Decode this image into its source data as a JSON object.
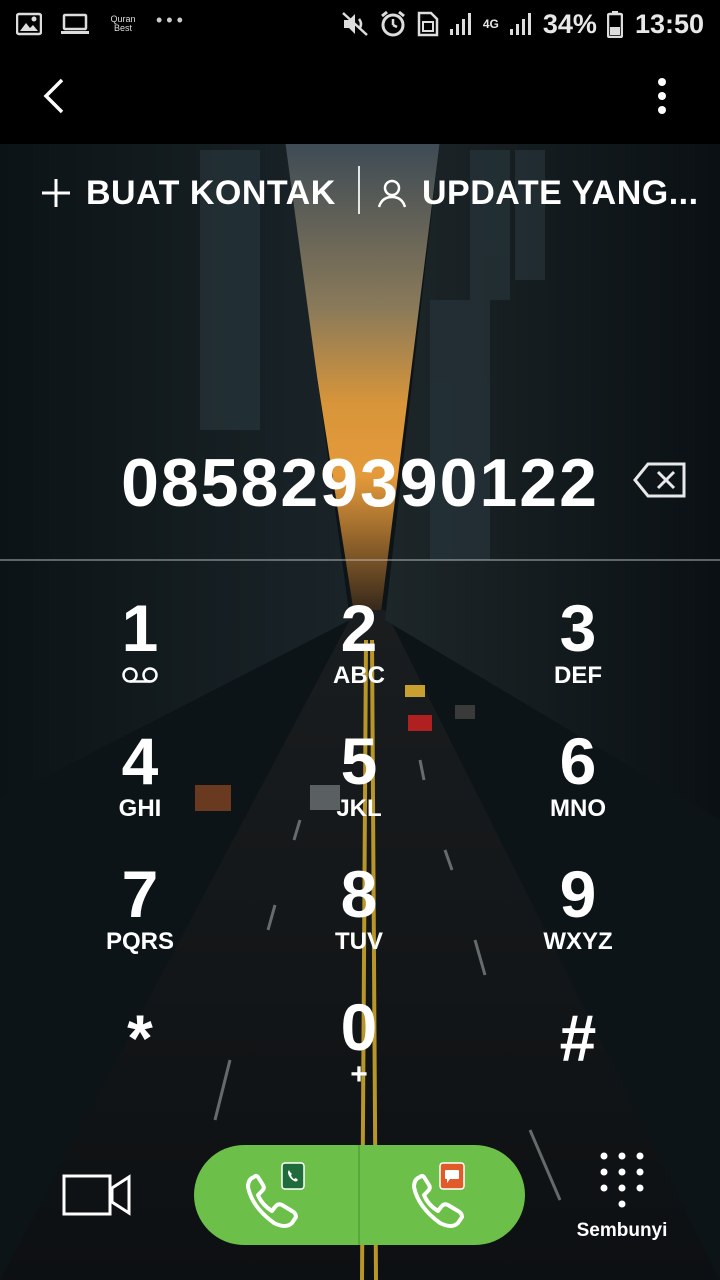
{
  "status_bar": {
    "left_icons": [
      "gallery-icon",
      "laptop-icon",
      "quran-best-icon",
      "more-notifications-icon"
    ],
    "quran_label": "Quran Best",
    "right_icons": [
      "mute-icon",
      "alarm-icon",
      "sim-icon",
      "signal-icon",
      "4g-icon",
      "signal-icon",
      "battery-icon"
    ],
    "network": "4G",
    "battery": "34%",
    "time": "13:50"
  },
  "toolbar": {
    "back_icon": "chevron-left-icon",
    "more_icon": "kebab-menu-icon"
  },
  "actions": {
    "create_contact": "BUAT KONTAK",
    "update_existing": "UPDATE YANG..."
  },
  "dialer": {
    "number": "085829390122",
    "backspace_icon": "backspace-icon"
  },
  "keypad": [
    {
      "digit": "1",
      "letters": "",
      "extra": "voicemail"
    },
    {
      "digit": "2",
      "letters": "ABC"
    },
    {
      "digit": "3",
      "letters": "DEF"
    },
    {
      "digit": "4",
      "letters": "GHI"
    },
    {
      "digit": "5",
      "letters": "JKL"
    },
    {
      "digit": "6",
      "letters": "MNO"
    },
    {
      "digit": "7",
      "letters": "PQRS"
    },
    {
      "digit": "8",
      "letters": "TUV"
    },
    {
      "digit": "9",
      "letters": "WXYZ"
    },
    {
      "digit": "*",
      "letters": ""
    },
    {
      "digit": "0",
      "letters": "+"
    },
    {
      "digit": "#",
      "letters": ""
    }
  ],
  "bottom": {
    "video_call_icon": "video-call-icon",
    "call_sim1_icon": "phone-sim1-icon",
    "call_sim2_icon": "phone-sim2-icon",
    "hide_label": "Sembunyi"
  },
  "colors": {
    "call_green": "#6cc04a",
    "sim1_badge": "#1f6b3a",
    "sim2_badge": "#e05a2a",
    "statusbar_bg": "#000000"
  }
}
